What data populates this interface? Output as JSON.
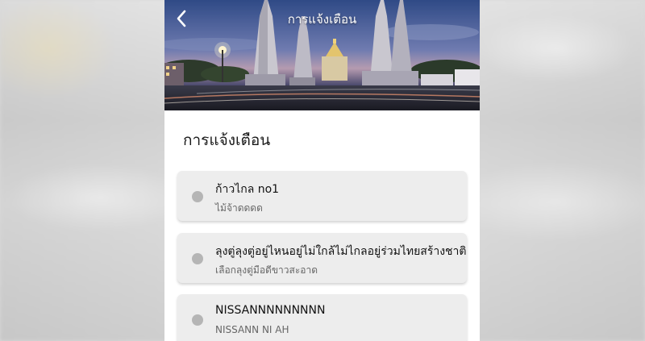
{
  "header": {
    "title": "การแจ้งเตือน",
    "back_icon": "chevron-left-icon"
  },
  "section": {
    "title": "การแจ้งเตือน"
  },
  "notifications": [
    {
      "title": "ก้าวไกล no1",
      "subtitle": "ไม้จ้าดดดด",
      "read": true
    },
    {
      "title": "ลุงตู่ลุงตู่อยู่ไหนอยู่ไม่ใกล้ไม่ไกลอยู่ร่วมไทยสร้างชาติ",
      "subtitle": "เลือกลุงตู่มือดีขาวสะอาด",
      "read": true
    },
    {
      "title": "NISSANNNNNNNNN",
      "subtitle": "NISSANN NI AH",
      "read": true
    }
  ],
  "colors": {
    "card_bg": "#ededed",
    "dot": "#b5b5b5",
    "header_text": "#ffffff"
  }
}
